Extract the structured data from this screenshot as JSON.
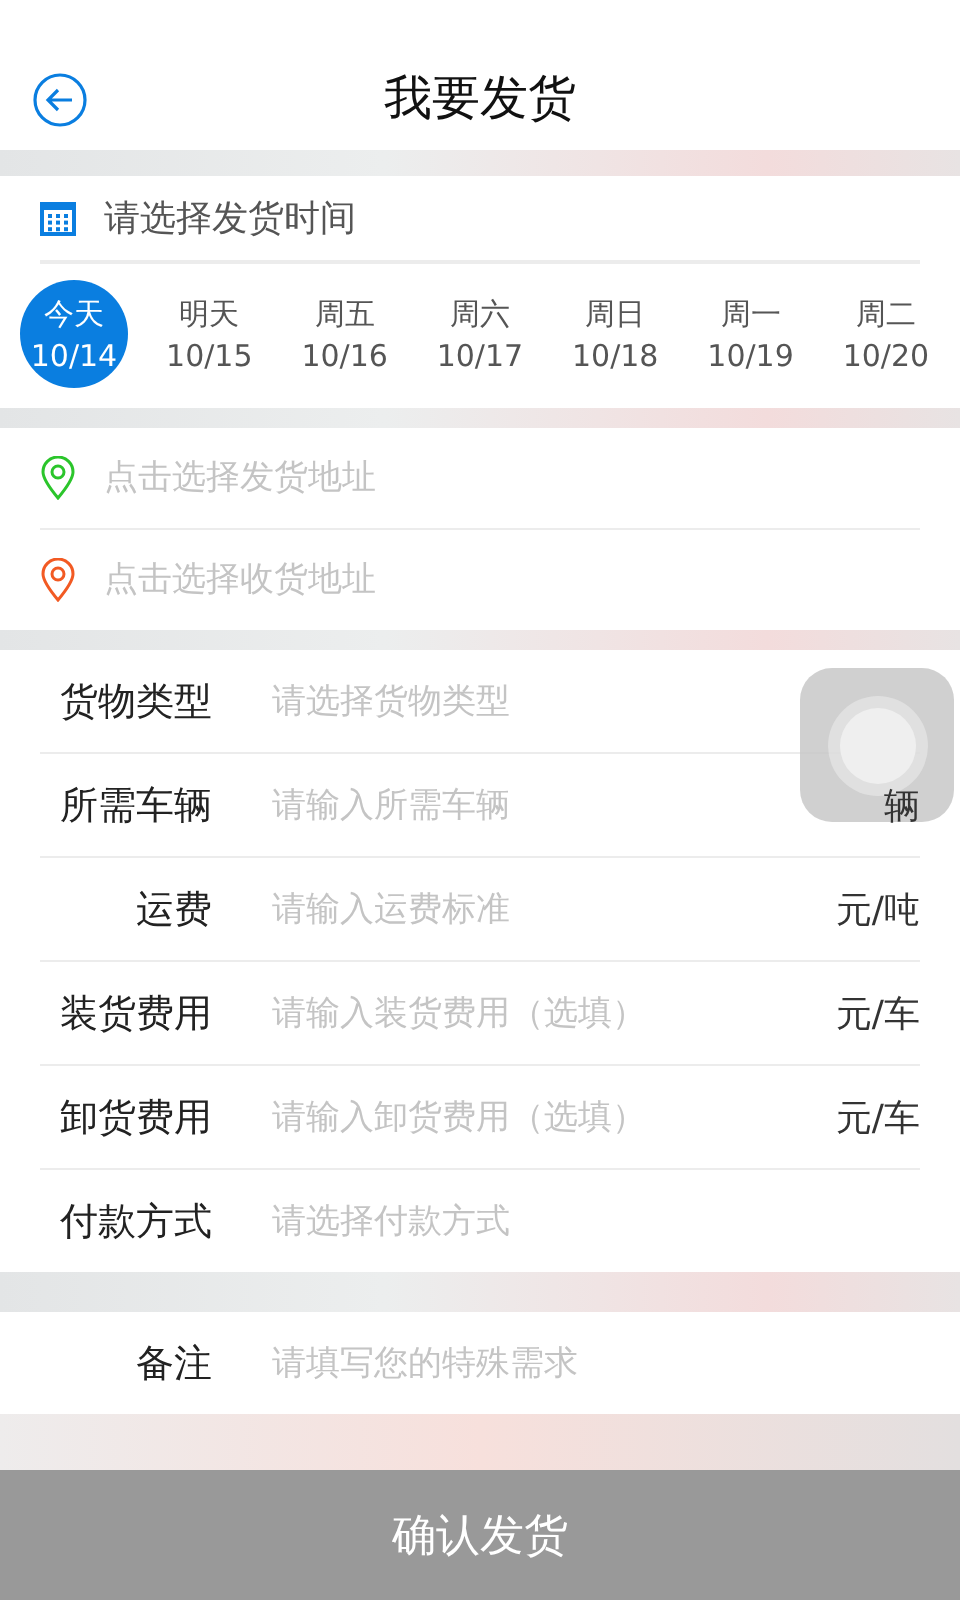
{
  "header": {
    "title": "我要发货"
  },
  "date_picker": {
    "prompt": "请选择发货时间",
    "days": [
      {
        "weekday": "今天",
        "date": "10/14",
        "selected": true
      },
      {
        "weekday": "明天",
        "date": "10/15",
        "selected": false
      },
      {
        "weekday": "周五",
        "date": "10/16",
        "selected": false
      },
      {
        "weekday": "周六",
        "date": "10/17",
        "selected": false
      },
      {
        "weekday": "周日",
        "date": "10/18",
        "selected": false
      },
      {
        "weekday": "周一",
        "date": "10/19",
        "selected": false
      },
      {
        "weekday": "周二",
        "date": "10/20",
        "selected": false
      }
    ]
  },
  "addresses": [
    {
      "kind": "origin",
      "placeholder": "点击选择发货地址"
    },
    {
      "kind": "destination",
      "placeholder": "点击选择收货地址"
    }
  ],
  "form": [
    {
      "label": "货物类型",
      "placeholder": "请选择货物类型"
    },
    {
      "label": "所需车辆",
      "placeholder": "请输入所需车辆",
      "unit": "辆"
    },
    {
      "label": "运费",
      "placeholder": "请输入运费标准",
      "unit": "元/吨"
    },
    {
      "label": "装货费用",
      "placeholder": "请输入装货费用（选填）",
      "unit": "元/车"
    },
    {
      "label": "卸货费用",
      "placeholder": "请输入卸货费用（选填）",
      "unit": "元/车"
    },
    {
      "label": "付款方式",
      "placeholder": "请选择付款方式"
    }
  ],
  "note": {
    "label": "备注",
    "placeholder": "请填写您的特殊需求"
  },
  "submit_button": "确认发货"
}
